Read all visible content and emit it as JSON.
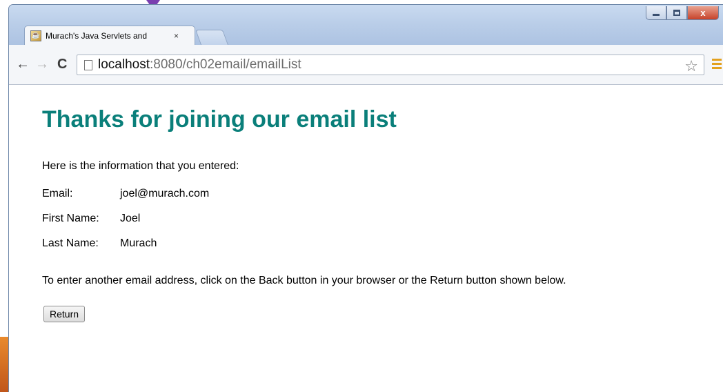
{
  "window": {
    "controls": {
      "close_glyph": "x"
    }
  },
  "tab": {
    "title": "Murach's Java Servlets and",
    "close_glyph": "×"
  },
  "toolbar": {
    "url_host": "localhost",
    "url_rest": ":8080/ch02email/emailList"
  },
  "icons": {
    "back": "back-arrow-icon",
    "forward": "forward-arrow-icon",
    "reload": "reload-icon",
    "page": "page-icon",
    "star": "star-icon",
    "menu": "menu-icon"
  },
  "page": {
    "heading": "Thanks for joining our email list",
    "intro": "Here is the information that you entered:",
    "fields": [
      {
        "label": "Email:",
        "value": "joel@murach.com"
      },
      {
        "label": "First Name:",
        "value": "Joel"
      },
      {
        "label": "Last Name:",
        "value": "Murach"
      }
    ],
    "note": "To enter another email address, click on the Back button in your browser or the Return button shown below.",
    "return_label": "Return"
  },
  "colors": {
    "heading": "#0a7f7a",
    "titlebar": "#b9cde8",
    "accent_orange": "#e98a2c"
  }
}
